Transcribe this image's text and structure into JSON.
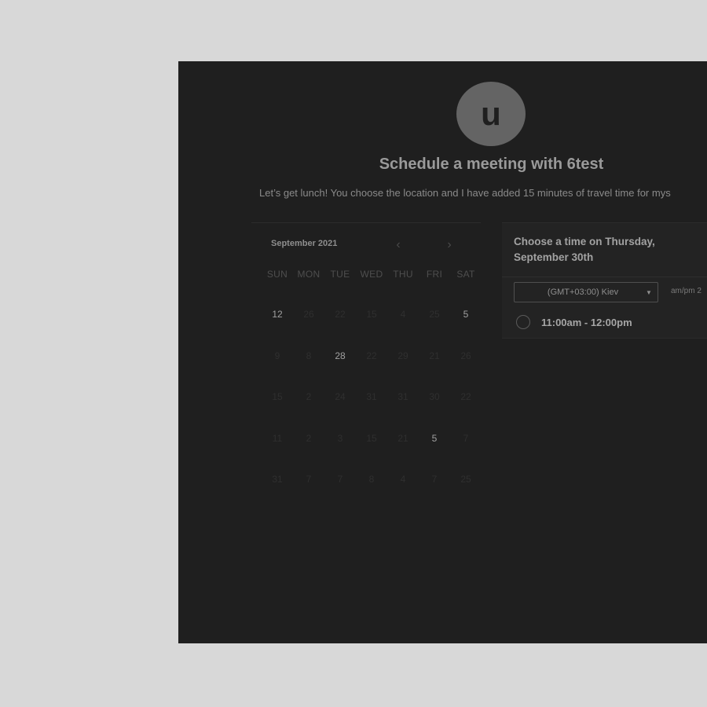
{
  "avatar": {
    "initial": "u"
  },
  "header": {
    "title": "Schedule a meeting with 6test",
    "description": "Let’s get lunch! You choose the location and I have added 15 minutes of travel time for mys"
  },
  "calendar": {
    "month": "September 2021",
    "prev_icon": "chevron-left-icon",
    "next_icon": "chevron-right-icon",
    "prev_glyph": "‹",
    "next_glyph": "›",
    "weekdays": [
      "SUN",
      "MON",
      "TUE",
      "WED",
      "THU",
      "FRI",
      "SAT"
    ],
    "weeks": [
      [
        {
          "d": "12",
          "a": true
        },
        {
          "d": "26",
          "a": false
        },
        {
          "d": "22",
          "a": false
        },
        {
          "d": "15",
          "a": false
        },
        {
          "d": "4",
          "a": false
        },
        {
          "d": "25",
          "a": false
        },
        {
          "d": "5",
          "a": true
        }
      ],
      [
        {
          "d": "9",
          "a": false
        },
        {
          "d": "8",
          "a": false
        },
        {
          "d": "28",
          "a": true
        },
        {
          "d": "22",
          "a": false
        },
        {
          "d": "29",
          "a": false
        },
        {
          "d": "21",
          "a": false
        },
        {
          "d": "26",
          "a": false
        }
      ],
      [
        {
          "d": "15",
          "a": false
        },
        {
          "d": "2",
          "a": false
        },
        {
          "d": "24",
          "a": false
        },
        {
          "d": "31",
          "a": false
        },
        {
          "d": "31",
          "a": false
        },
        {
          "d": "30",
          "a": false
        },
        {
          "d": "22",
          "a": false
        }
      ],
      [
        {
          "d": "11",
          "a": false
        },
        {
          "d": "2",
          "a": false
        },
        {
          "d": "3",
          "a": false
        },
        {
          "d": "15",
          "a": false
        },
        {
          "d": "21",
          "a": false
        },
        {
          "d": "5",
          "a": true
        },
        {
          "d": "7",
          "a": false
        }
      ],
      [
        {
          "d": "31",
          "a": false
        },
        {
          "d": "7",
          "a": false
        },
        {
          "d": "7",
          "a": false
        },
        {
          "d": "8",
          "a": false
        },
        {
          "d": "4",
          "a": false
        },
        {
          "d": "7",
          "a": false
        },
        {
          "d": "25",
          "a": false
        }
      ]
    ]
  },
  "times": {
    "heading_line1": "Choose a time on Thursday,",
    "heading_line2": "September 30th",
    "timezone": "(GMT+03:00) Kiev",
    "format_label": "am/pm  2",
    "slots": [
      "11:00am - 12:00pm"
    ]
  },
  "colors": {
    "panel_bg": "#1f1f1f",
    "page_bg": "#d8d8d8"
  }
}
